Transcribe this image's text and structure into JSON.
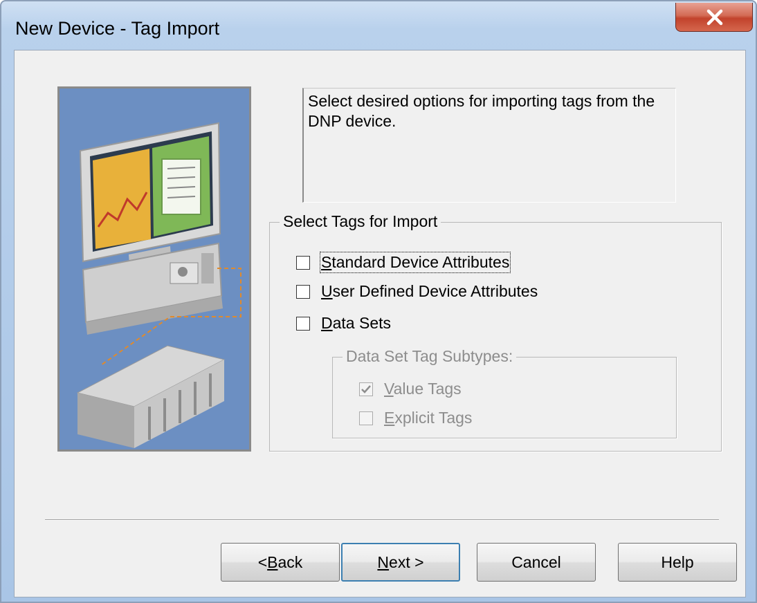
{
  "window": {
    "title": "New Device - Tag Import",
    "close_icon": "close-icon"
  },
  "description": "Select desired options for importing tags from the DNP device.",
  "tag_group": {
    "legend": "Select Tags for Import",
    "options": [
      {
        "pre": "",
        "key": "S",
        "rest": "tandard Device Attributes",
        "checked": false,
        "enabled": true,
        "focused": true
      },
      {
        "pre": "",
        "key": "U",
        "rest": "ser Defined Device Attributes",
        "checked": false,
        "enabled": true,
        "focused": false
      },
      {
        "pre": "",
        "key": "D",
        "rest": "ata Sets",
        "checked": false,
        "enabled": true,
        "focused": false
      }
    ]
  },
  "subtype_group": {
    "legend": "Data Set Tag Subtypes:",
    "options": [
      {
        "pre": "",
        "key": "V",
        "rest": "alue Tags",
        "checked": true,
        "enabled": false
      },
      {
        "pre": "",
        "key": "E",
        "rest": "xplicit Tags",
        "checked": false,
        "enabled": false
      }
    ]
  },
  "buttons": {
    "back": {
      "pre": "< ",
      "key": "B",
      "rest": "ack"
    },
    "next": {
      "pre": "",
      "key": "N",
      "rest": "ext >"
    },
    "cancel": {
      "pre": "",
      "key": "",
      "rest": "Cancel"
    },
    "help": {
      "pre": "",
      "key": "",
      "rest": "Help"
    }
  },
  "colors": {
    "illustration_bg": "#6c8fc2",
    "default_button_border": "#3c7fb1",
    "disabled_text": "#8d8d8d"
  }
}
